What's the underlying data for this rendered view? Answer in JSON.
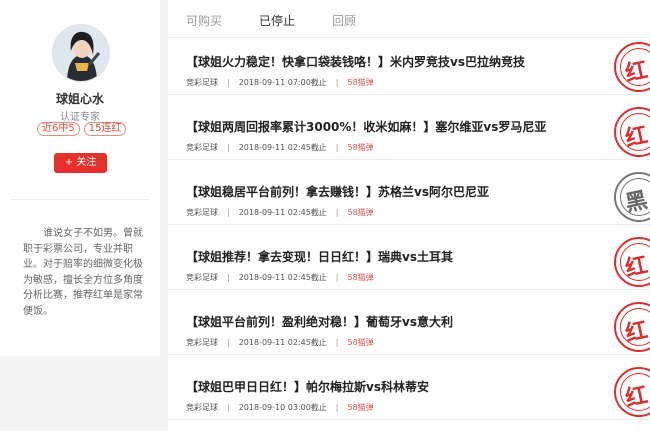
{
  "sidebar": {
    "name": "球姐心水",
    "title": "认证专家",
    "badges": [
      "近6中5",
      "15连红"
    ],
    "follow_label": "+ 关注",
    "bio": "谁说女子不如男。曾就职于彩票公司，专业并职业。对于赔率的细微变化极为敏感，擅长全方位多角度分析比赛，推荐红单是家常便饭。"
  },
  "tabs": [
    {
      "label": "可购买",
      "active": false
    },
    {
      "label": "已停止",
      "active": true
    },
    {
      "label": "回顾",
      "active": false
    }
  ],
  "items": [
    {
      "title": "【球姐火力稳定！快拿口袋装钱咯！】米内罗竞技vs巴拉纳竞技",
      "category": "竞彩足球",
      "time": "2018-09-11 07:00截止",
      "price": "58猫弹",
      "result": "红",
      "result_color": "#d92f2f"
    },
    {
      "title": "【球姐两周回报率累计3000%！收米如麻！】塞尔维亚vs罗马尼亚",
      "category": "竞彩足球",
      "time": "2018-09-11 02:45截止",
      "price": "58猫弹",
      "result": "红",
      "result_color": "#d92f2f"
    },
    {
      "title": "【球姐稳居平台前列！拿去赚钱！】苏格兰vs阿尔巴尼亚",
      "category": "竞彩足球",
      "time": "2018-09-11 02:45截止",
      "price": "58猫弹",
      "result": "黑",
      "result_color": "#666666"
    },
    {
      "title": "【球姐推荐！拿去变现！日日红！】瑞典vs土耳其",
      "category": "竞彩足球",
      "time": "2018-09-11 02:45截止",
      "price": "58猫弹",
      "result": "红",
      "result_color": "#d92f2f"
    },
    {
      "title": "【球姐平台前列！盈利绝对稳！】葡萄牙vs意大利",
      "category": "竞彩足球",
      "time": "2018-09-11 02:45截止",
      "price": "58猫弹",
      "result": "红",
      "result_color": "#d92f2f"
    },
    {
      "title": "【球姐巴甲日日红！】帕尔梅拉斯vs科林蒂安",
      "category": "竞彩足球",
      "time": "2018-09-10 03:00截止",
      "price": "58猫弹",
      "result": "红",
      "result_color": "#d92f2f"
    }
  ]
}
